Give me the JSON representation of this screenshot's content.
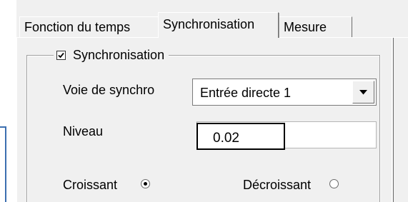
{
  "tabs": [
    {
      "label": "Fonction du temps",
      "active": false
    },
    {
      "label": "Synchronisation",
      "active": true
    },
    {
      "label": "Mesure",
      "active": false
    }
  ],
  "group": {
    "title": "Synchronisation",
    "checked": true
  },
  "voie": {
    "label": "Voie de synchro",
    "value": "Entrée directe 1"
  },
  "niveau": {
    "label": "Niveau",
    "value": "0.02"
  },
  "radios": {
    "croissant": {
      "label": "Croissant",
      "selected": true
    },
    "decroissant": {
      "label": "Décroissant",
      "selected": false
    }
  },
  "icons": {
    "check": "check-icon",
    "dropdown": "chevron-down-icon"
  }
}
